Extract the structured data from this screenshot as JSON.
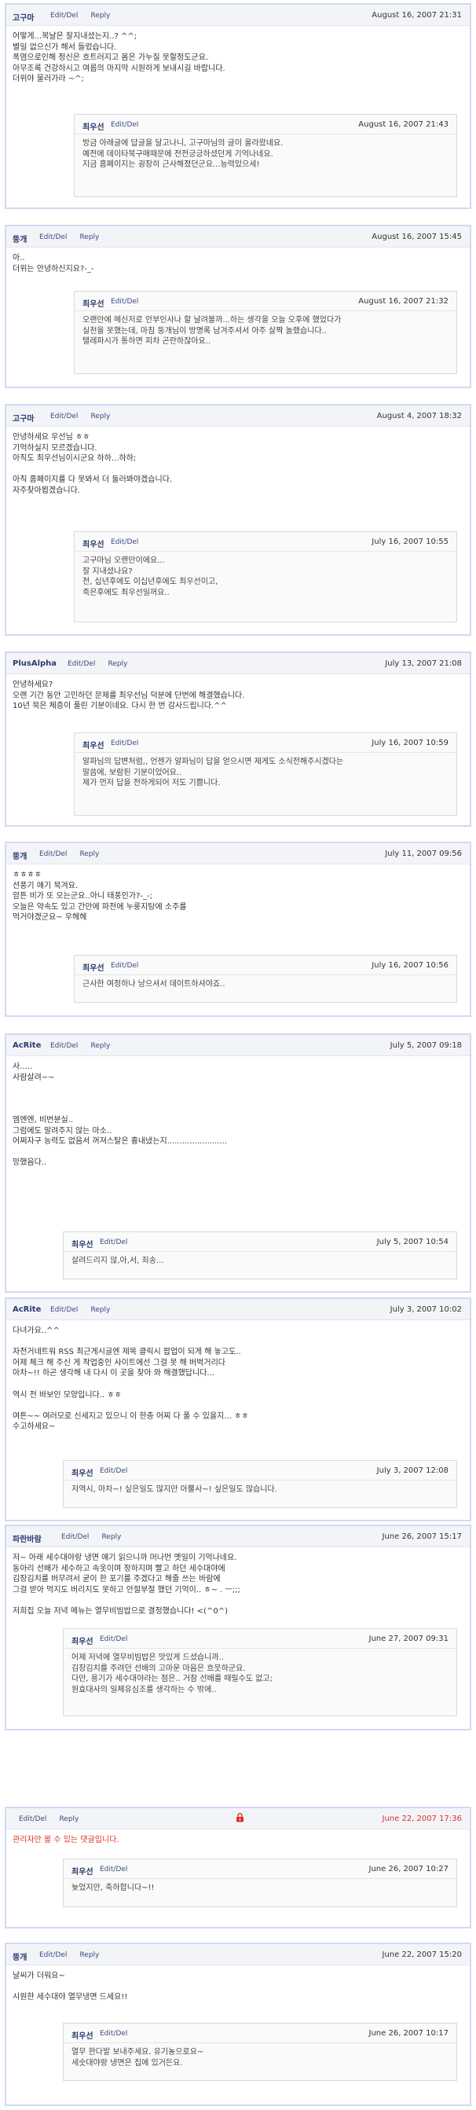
{
  "labels": {
    "edit": "Edit/Del",
    "reply": "Reply"
  },
  "entries": [
    {
      "author": "고구마",
      "date": "August 16, 2007 21:31",
      "text": "어떻게...복날은 잘지내셨는지..? ^^;\n별일 없으신가 해서 들렀습니다.\n폭염으로인해 정신은 흐트러지고 몸은 가누질 못할정도군요.\n아무조록 건강하시고 여름의 마지막 시원하게 보내시길 바랍니다.\n더위야 물러가라 ~^;",
      "reply": {
        "author": "최우선",
        "date": "August 16, 2007 21:43",
        "text": "방금 아래글에 답글을 달고나니, 고구마님의 글이 올라왔네요.\n예전에 데이타북구매때문에 전전긍긍하셨던게 기억나네요.\n지금 홈페이지는 굉장히 근사해졌던군요...능력있으세!"
      }
    },
    {
      "author": "뚱개",
      "date": "August 16, 2007 15:45",
      "text": "아..\n더위는 안녕하신지요?-_-",
      "reply": {
        "author": "최우선",
        "date": "August 16, 2007 21:32",
        "text": "오랜만에 메신저로 안부인사나 할 날려볼까...하는 생각을 오늘 오후에 했었다가\n실천을 못했는데, 마침 뚱개님이 방명록 남겨주셔서 아주 살짝 놀랬습니다..\n텔레파시가 통하면 피차 곤란하잖아요.."
      }
    },
    {
      "author": "고구마",
      "date": "August 4, 2007 18:32",
      "text": "안녕하세요 우선님 ㅎㅎ\n기억하실지 모르겠습니다.\n아직도 최우선님이시군요 하하...하하;\n\n아직 홈페이지를 다 못봐서 더 둘러봐야겠습니다.\n자주찾아뵙겠습니다.",
      "reply": {
        "author": "최우선",
        "date": "July 16, 2007 10:55",
        "text": "고구마님 오랜만이에요...\n잘 지내셨나요?\n전, 십년후에도 이십년후에도 최우선이고,\n죽은후에도 최우선일꺼요.."
      }
    },
    {
      "author": "PlusAlpha",
      "date": "July 13, 2007 21:08",
      "text": "안녕하세요?\n오랜 기간 동안 고민하던 문제를 최우선님 덕분에 단번에 해결했습니다.\n10년 묵은 체증이 풀린 기분이네요. 다시 한 번 감사드립니다.^^",
      "reply": {
        "author": "최우선",
        "date": "July 16, 2007 10:59",
        "text": "알파님의 답변처럼,, 언젠가 알파님이 답을 얻으시면 제게도 소식전해주시겠다는\n말씀에, 보람된 기분이었어요..\n제가 먼저 답을 전하게되어 저도 기쁩니다."
      }
    },
    {
      "author": "뚱개",
      "date": "July 11, 2007 09:56",
      "text": "ㅎㅎㅎㅎ\n선풍기 얘기 묵겨요.\n암튼 비가 또 오는군요..아니 태풍인가?-_-;\n오늘은 약속도 있고 간만에 파전에 누룽지탕에 소주를\n먹거야겠군요~ 우헤헤",
      "reply": {
        "author": "최우선",
        "date": "July 16, 2007 10:56",
        "text": "근사한 여정하나 남으셔서 데이트하셔야죠.."
      }
    },
    {
      "author": "AcRite",
      "date": "July 5, 2007 09:18",
      "text": "사.....\n사람살려~~\n\n\n\n엠엔엔, 비번분실..\n그럼에도 알려주지 않는 마소..\n어쩌자구 능력도 없음서 꺼져스탈은 흉내냈는지........................\n\n망했음다..",
      "reply": {
        "author": "최우선",
        "date": "July 5, 2007 10:54",
        "text": "살려드리지 않,아,서, 죄송..."
      }
    },
    {
      "author": "AcRite",
      "date": "July 3, 2007 10:02",
      "text": "다녀가요..^^\n\n자전거네트워 RSS 최근게시글엔 제목 클릭시 팝업이 되게 해 놓고도..\n어제 체크 해 주신 게 작업중인 사이트에선 그걸 못 해 버벅거리다\n아차~!! 하곤 생각해 내 다시 이 곳을 찾아 와 해결했답니다...\n\n역시 전 바보인 모양입니다.. ㅎㅎ\n\n여튼~~ 여러모로 신세지고 있으니 이 한층 어찌 다 풀 수 있을지... ㅎㅎ\n수고하세요~",
      "reply": {
        "author": "최우선",
        "date": "July 3, 2007 12:08",
        "text": "저역시, 아차~! 싶은일도 많지만 아뿔사~! 싶은일도 많습니다."
      }
    },
    {
      "author": "파란바람",
      "date": "June 26, 2007 15:17",
      "text": "저~ 아래 세수대야랑 냉면 얘기 읽으니까 머나먼 옛일이 기억나네요.\n동아리 선배가 세수하고 속옷이며 정하지며 빨고 하던 세수대야에\n김장김치를 버무려서 굳이 한 포기를 주겠다고 해줄 쓰는 바람에\n그걸 받아 먹지도 버리지도 못하고 안절부절 했던 기억이.. ㅎ~ . ㅡ;;;\n\n저희집 오늘 저녁 메뉴는 열무비빔밥으로 결정했습니다! <(^0^)",
      "reply": {
        "author": "최우선",
        "date": "June 27, 2007 09:31",
        "text": "어제 저녁에 열무비빔밥은 맛있게 드셨습니까..\n김장김치를 주려던 선배의 고마운 마음은 흐뭇하군요.\n다만, 용기가 세수대야라는 점은.. 거참 선배를 때릴수도 없고;\n원효대사의 일체유심조를 생각하는 수 밖에.."
      }
    },
    {
      "author": "",
      "date": "June 22, 2007 17:36",
      "date_red": true,
      "lock": true,
      "text": "관리자만 볼 수 있는 댓글입니다.",
      "text_red": true,
      "reply": {
        "author": "최우선",
        "date": "June 26, 2007 10:27",
        "text": "늦었지만, 축하합니다~!!"
      }
    },
    {
      "author": "뚱개",
      "date": "June 22, 2007 15:20",
      "text": "날씨가 더워요~\n\n시원한 세수대야 열무냉면 드세요!!",
      "reply": {
        "author": "최우선",
        "date": "June 26, 2007 10:17",
        "text": "열무 한다발 보내주세요. 유기농으로요~\n세숫대야랑 냉면은 집에 있거든요."
      }
    }
  ]
}
